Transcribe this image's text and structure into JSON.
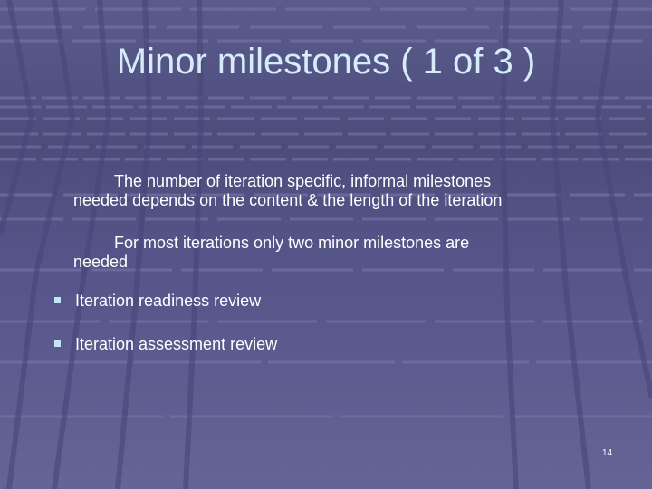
{
  "slide": {
    "title": "Minor milestones ( 1 of 3 )",
    "paragraphs": [
      {
        "line1": "The number of iteration specific, informal milestones",
        "line2": "needed depends on the content & the length of the iteration"
      },
      {
        "line1": "For most iterations only two minor milestones are",
        "line2": "needed"
      }
    ],
    "bullets": [
      {
        "text": "Iteration readiness review"
      },
      {
        "text": "Iteration assessment review"
      }
    ],
    "page_number": "14",
    "colors": {
      "background": "#55558a",
      "title_text": "#d6ecfb",
      "body_text": "#ffffff",
      "bullet_marker": "#c6e4f8"
    }
  }
}
